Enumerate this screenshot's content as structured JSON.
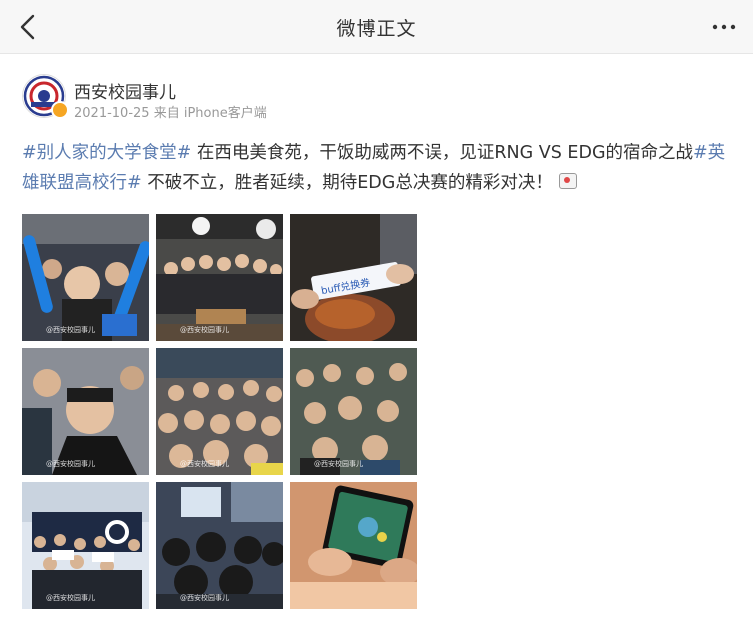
{
  "nav": {
    "title": "微博正文",
    "back_icon": "back-arrow-icon",
    "more_icon": "more-dots-icon"
  },
  "post": {
    "author": "西安校园事儿",
    "date": "2021-10-25",
    "source": "来自 iPhone客户端",
    "text": {
      "tag1": "#别人家的大学食堂#",
      "part1": " 在西电美食苑，干饭助威两不误，见证RNG VS EDG的宿命之战",
      "tag2": "#英雄联盟高校行#",
      "part2": " 不破不立，胜者延续，期待EDG总决赛的精彩对决！"
    },
    "photos": [
      {
        "label": "fans-with-blue-thundersticks"
      },
      {
        "label": "group-photo-cafeteria"
      },
      {
        "label": "buff-coupon-and-food",
        "printed": "buff兑换券"
      },
      {
        "label": "cheering-student-closeup"
      },
      {
        "label": "crowd-watching-match"
      },
      {
        "label": "crowd-reaction"
      },
      {
        "label": "outdoor-group-photo"
      },
      {
        "label": "students-watching-screen"
      },
      {
        "label": "phone-gameplay"
      }
    ],
    "watermark": "@西安校园事儿"
  },
  "colors": {
    "accent": "#5b7cb0",
    "meta": "#999999",
    "badge": "#f6a623"
  }
}
